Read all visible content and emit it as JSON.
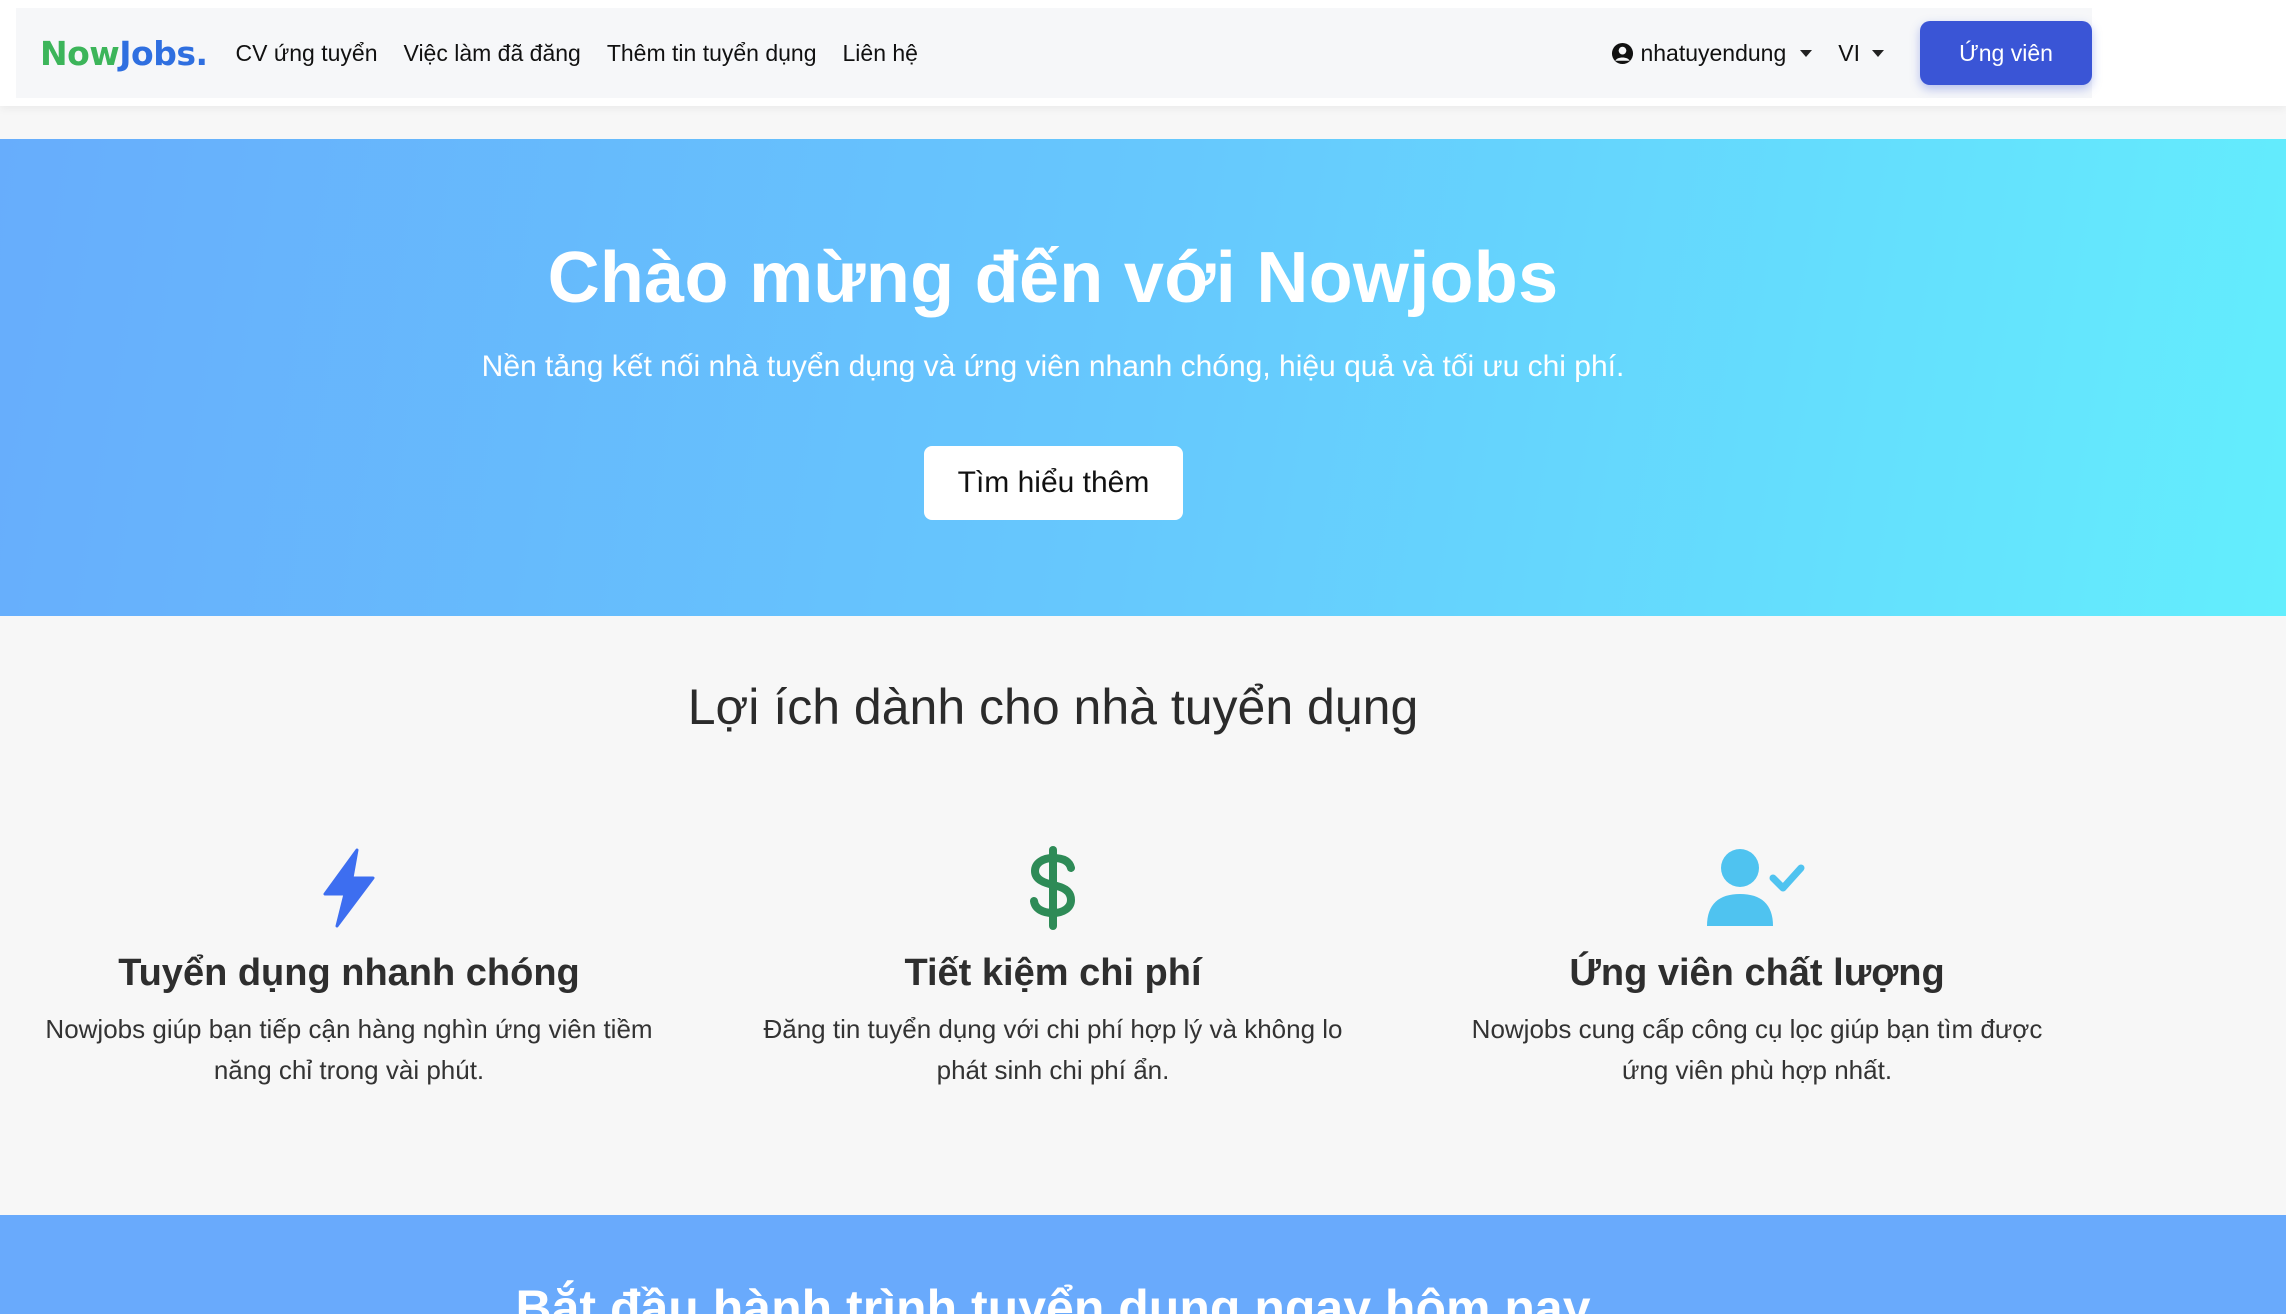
{
  "brand": {
    "part1": "Now",
    "part2": "Jobs."
  },
  "nav": {
    "links": [
      "CV ứng tuyển",
      "Việc làm đã đăng",
      "Thêm tin tuyển dụng",
      "Liên hệ"
    ],
    "user": "nhatuyendung",
    "language": "VI",
    "cta": "Ứng viên"
  },
  "hero": {
    "title": "Chào mừng đến với Nowjobs",
    "subtitle": "Nền tảng kết nối nhà tuyển dụng và ứng viên nhanh chóng, hiệu quả và tối ưu chi phí.",
    "button": "Tìm hiểu thêm"
  },
  "benefits": {
    "title": "Lợi ích dành cho nhà tuyển dụng",
    "items": [
      {
        "icon": "lightning-icon",
        "title": "Tuyển dụng nhanh chóng",
        "desc": "Nowjobs giúp bạn tiếp cận hàng nghìn ứng viên tiềm năng chỉ trong vài phút."
      },
      {
        "icon": "dollar-icon",
        "title": "Tiết kiệm chi phí",
        "desc": "Đăng tin tuyển dụng với chi phí hợp lý và không lo phát sinh chi phí ẩn."
      },
      {
        "icon": "user-check-icon",
        "title": "Ứng viên chất lượng",
        "desc": "Nowjobs cung cấp công cụ lọc giúp bạn tìm được ứng viên phù hợp nhất."
      }
    ]
  },
  "bottom": {
    "title": "Bắt đầu hành trình tuyển dụng ngay hôm nay"
  },
  "colors": {
    "brand_green": "#3cb55a",
    "brand_blue": "#2f6fe0",
    "cta_blue": "#3a55d6",
    "lightning": "#3d6ef0",
    "dollar": "#2e8b57",
    "user": "#4fc3f0"
  }
}
